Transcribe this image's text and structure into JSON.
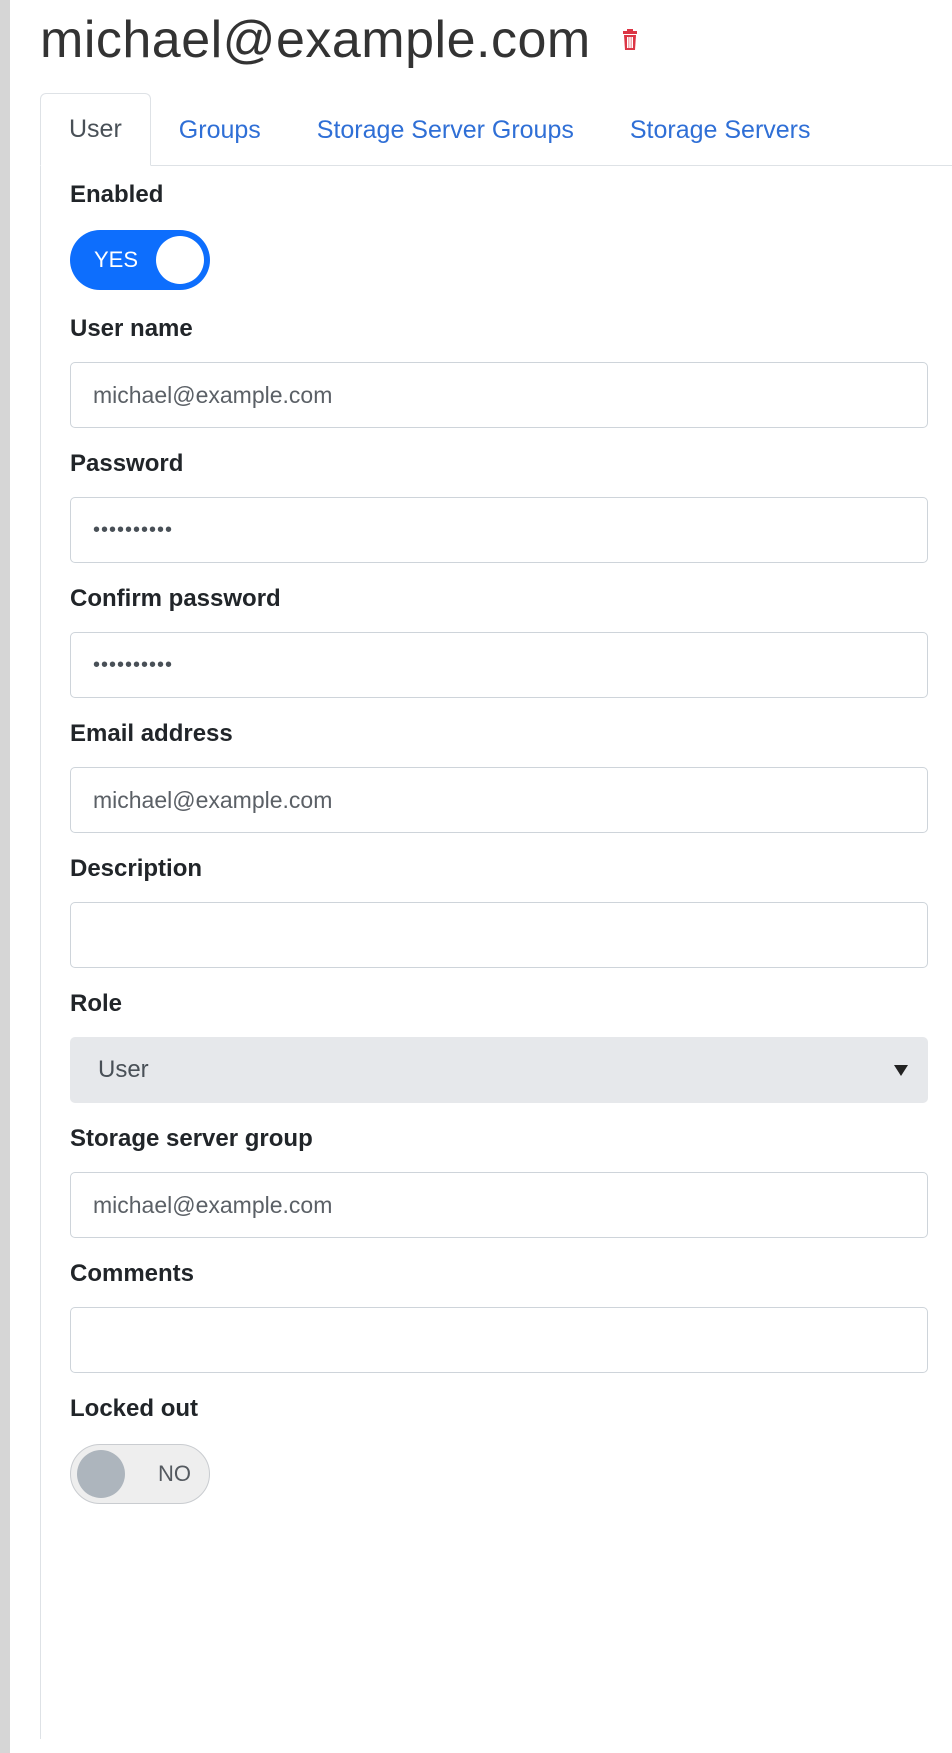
{
  "header": {
    "title": "michael@example.com",
    "delete_icon": "trash-icon",
    "delete_color": "#dc3545"
  },
  "tabs": [
    {
      "label": "User",
      "active": true
    },
    {
      "label": "Groups",
      "active": false
    },
    {
      "label": "Storage Server Groups",
      "active": false
    },
    {
      "label": "Storage Servers",
      "active": false
    }
  ],
  "form": {
    "enabled": {
      "label": "Enabled",
      "value": "YES",
      "on": true
    },
    "user_name": {
      "label": "User name",
      "value": "michael@example.com"
    },
    "password": {
      "label": "Password",
      "value": "••••••••••"
    },
    "confirm_password": {
      "label": "Confirm password",
      "value": "••••••••••"
    },
    "email": {
      "label": "Email address",
      "value": "michael@example.com"
    },
    "description": {
      "label": "Description",
      "value": ""
    },
    "role": {
      "label": "Role",
      "value": "User"
    },
    "storage_server_group": {
      "label": "Storage server group",
      "value": "michael@example.com"
    },
    "comments": {
      "label": "Comments",
      "value": ""
    },
    "locked_out": {
      "label": "Locked out",
      "value": "NO",
      "on": false
    }
  },
  "colors": {
    "accent": "#0d6efd",
    "link": "#2f6fd6",
    "select_bg": "#e6e8eb"
  }
}
